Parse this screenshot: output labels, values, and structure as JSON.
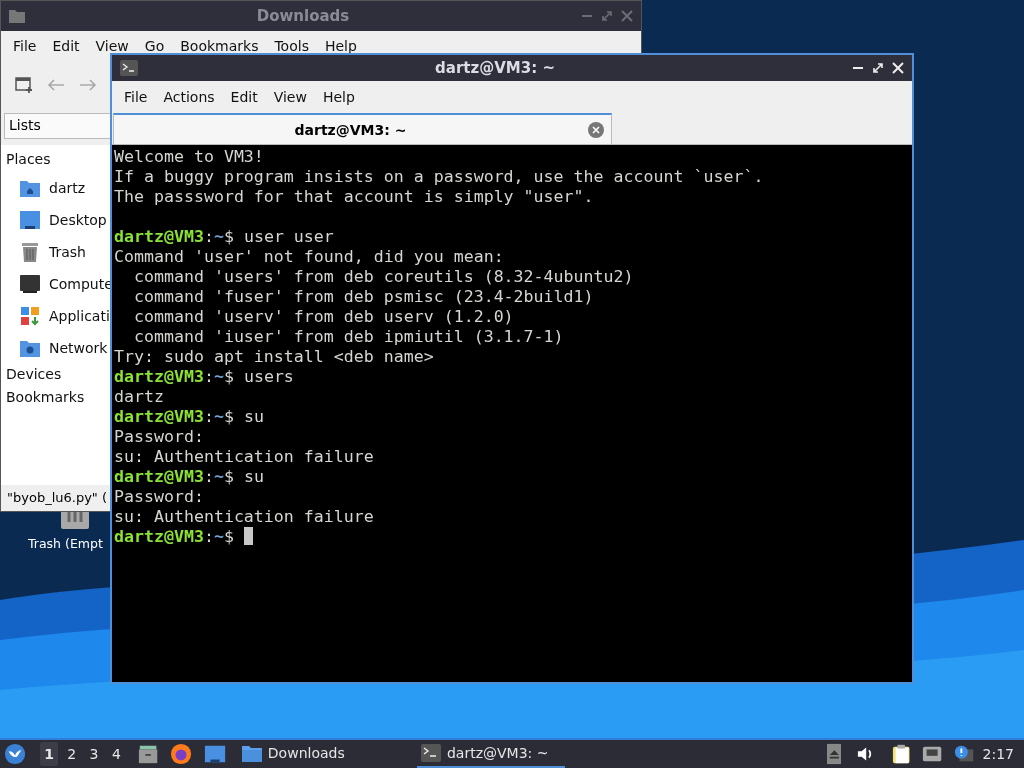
{
  "desktop": {
    "icons": [
      {
        "label": "Trash (Empt",
        "kind": "trash"
      }
    ]
  },
  "file_manager": {
    "title": "Downloads",
    "menu": [
      "File",
      "Edit",
      "View",
      "Go",
      "Bookmarks",
      "Tools",
      "Help"
    ],
    "side_pane": {
      "view": "Lists",
      "sections": [
        {
          "label": "Places",
          "items": [
            {
              "label": "dartz",
              "kind": "home"
            },
            {
              "label": "Desktop",
              "kind": "desktop"
            },
            {
              "label": "Trash",
              "kind": "trash"
            },
            {
              "label": "Compute",
              "kind": "computer"
            },
            {
              "label": "Applicati",
              "kind": "applications"
            },
            {
              "label": "Network",
              "kind": "network"
            }
          ]
        },
        {
          "label": "Devices"
        },
        {
          "label": "Bookmarks"
        }
      ]
    },
    "status": "\"byob_lu6.py\" ("
  },
  "terminal": {
    "title": "dartz@VM3: ~",
    "menu": [
      "File",
      "Actions",
      "Edit",
      "View",
      "Help"
    ],
    "tabs": [
      {
        "label": "dartz@VM3: ~",
        "selected": true
      }
    ],
    "lines": [
      {
        "kind": "output",
        "text": "Welcome to VM3!"
      },
      {
        "kind": "output",
        "text": "If a buggy program insists on a password, use the account `user`."
      },
      {
        "kind": "output",
        "text": "The passsword for that account is simply \"user\"."
      },
      {
        "kind": "blank"
      },
      {
        "kind": "prompt",
        "user": "dartz@VM3",
        "sep": ":",
        "path": "~",
        "symbol": "$ ",
        "command": "user user"
      },
      {
        "kind": "output",
        "text": "Command 'user' not found, did you mean:"
      },
      {
        "kind": "output",
        "text": "  command 'users' from deb coreutils (8.32-4ubuntu2)"
      },
      {
        "kind": "output",
        "text": "  command 'fuser' from deb psmisc (23.4-2build1)"
      },
      {
        "kind": "output",
        "text": "  command 'userv' from deb userv (1.2.0)"
      },
      {
        "kind": "output",
        "text": "  command 'iuser' from deb ipmiutil (3.1.7-1)"
      },
      {
        "kind": "output",
        "text": "Try: sudo apt install <deb name>"
      },
      {
        "kind": "prompt",
        "user": "dartz@VM3",
        "sep": ":",
        "path": "~",
        "symbol": "$ ",
        "command": "users"
      },
      {
        "kind": "output",
        "text": "dartz"
      },
      {
        "kind": "prompt",
        "user": "dartz@VM3",
        "sep": ":",
        "path": "~",
        "symbol": "$ ",
        "command": "su"
      },
      {
        "kind": "output",
        "text": "Password:"
      },
      {
        "kind": "output",
        "text": "su: Authentication failure"
      },
      {
        "kind": "prompt",
        "user": "dartz@VM3",
        "sep": ":",
        "path": "~",
        "symbol": "$ ",
        "command": "su"
      },
      {
        "kind": "output",
        "text": "Password:"
      },
      {
        "kind": "output",
        "text": "su: Authentication failure"
      },
      {
        "kind": "prompt",
        "user": "dartz@VM3",
        "sep": ":",
        "path": "~",
        "symbol": "$ "
      }
    ],
    "cursor": true
  },
  "taskbar": {
    "workspaces": [
      {
        "label": "1",
        "selected": true
      },
      {
        "label": "2",
        "selected": false
      },
      {
        "label": "3",
        "selected": false
      },
      {
        "label": "4",
        "selected": false
      }
    ],
    "tasks": [
      {
        "label": "Downloads",
        "kind": "folder",
        "selected": false
      },
      {
        "label": "dartz@VM3: ~",
        "kind": "terminal",
        "selected": true
      }
    ],
    "clock": "2:17"
  }
}
